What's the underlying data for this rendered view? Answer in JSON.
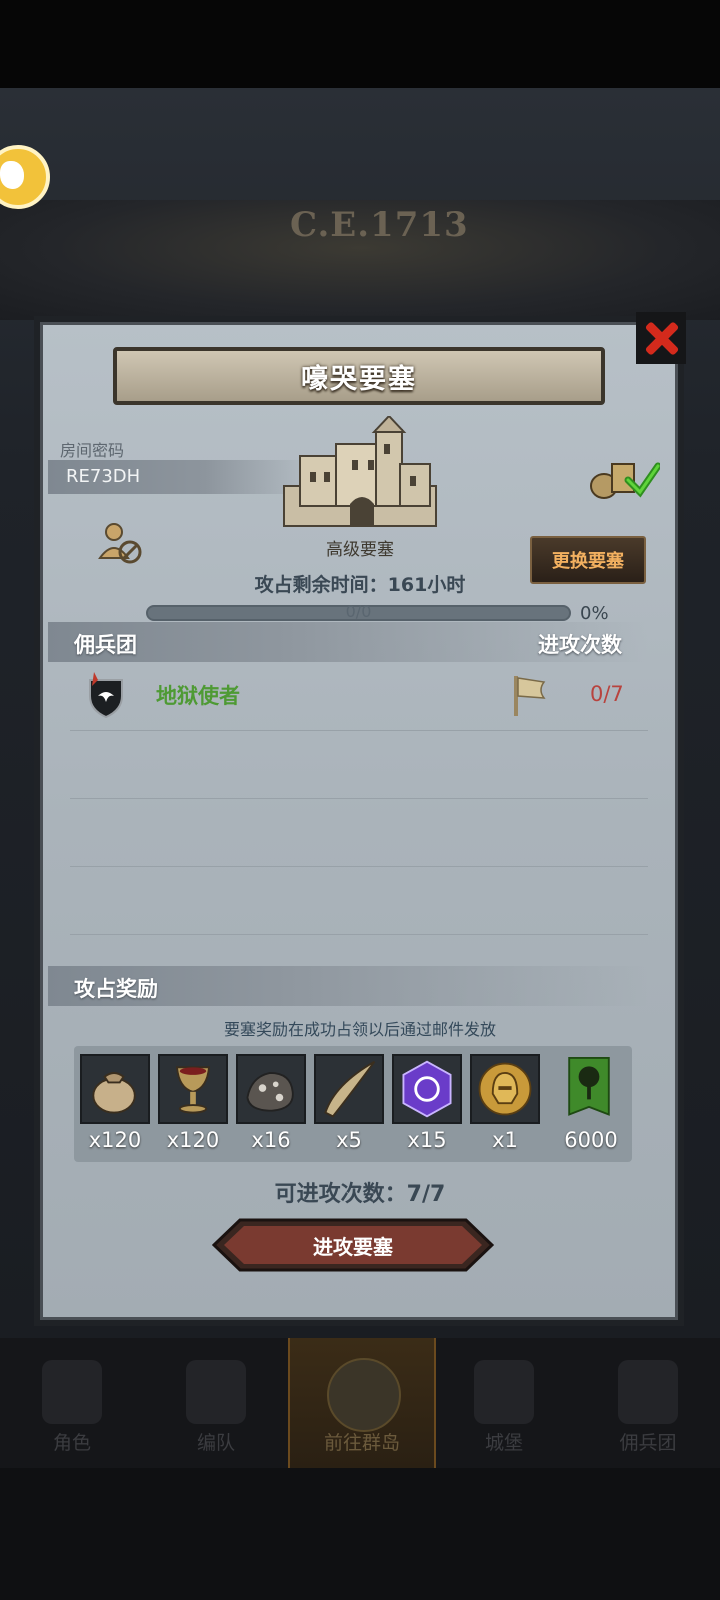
{
  "background": {
    "era": "C.E.1713"
  },
  "dialog": {
    "title": "嚎哭要塞",
    "room_label": "房间密码",
    "room_code": "RE73DH",
    "fortress_type": "高级要塞",
    "change_button": "更换要塞",
    "time_label": "攻占剩余时间：161小时",
    "progress": {
      "count_text": "0/0",
      "percent_text": "0%",
      "fraction": 0
    },
    "mercenaries": {
      "header": "佣兵团",
      "attacks_header": "进攻次数",
      "rows": [
        {
          "name": "地狱使者",
          "attacks": "0/7"
        }
      ]
    },
    "rewards": {
      "header": "攻占奖励",
      "note": "要塞奖励在成功占领以后通过邮件发放",
      "items": [
        {
          "icon": "sack-icon",
          "qty": "x120"
        },
        {
          "icon": "goblet-icon",
          "qty": "x120"
        },
        {
          "icon": "ore-icon",
          "qty": "x16"
        },
        {
          "icon": "horn-icon",
          "qty": "x5"
        },
        {
          "icon": "purple-rune-icon",
          "qty": "x15"
        },
        {
          "icon": "gold-helmet-icon",
          "qty": "x1"
        },
        {
          "icon": "tree-banner-icon",
          "qty": "6000"
        }
      ]
    },
    "attacks_available": "可进攻次数：7/7",
    "attack_button": "进攻要塞"
  },
  "bottom_nav": [
    {
      "label": "角色",
      "icon": "knight-icon"
    },
    {
      "label": "编队",
      "icon": "helmet-icon"
    },
    {
      "label": "前往群岛",
      "icon": "globe-icon",
      "active": true
    },
    {
      "label": "城堡",
      "icon": "castle-icon"
    },
    {
      "label": "佣兵团",
      "icon": "ship-icon"
    }
  ],
  "colors": {
    "accent_red": "#d42a1c",
    "merc_name_green": "#4e9a34",
    "attack_count_red": "#b8433e",
    "change_button_text": "#f2b060"
  }
}
